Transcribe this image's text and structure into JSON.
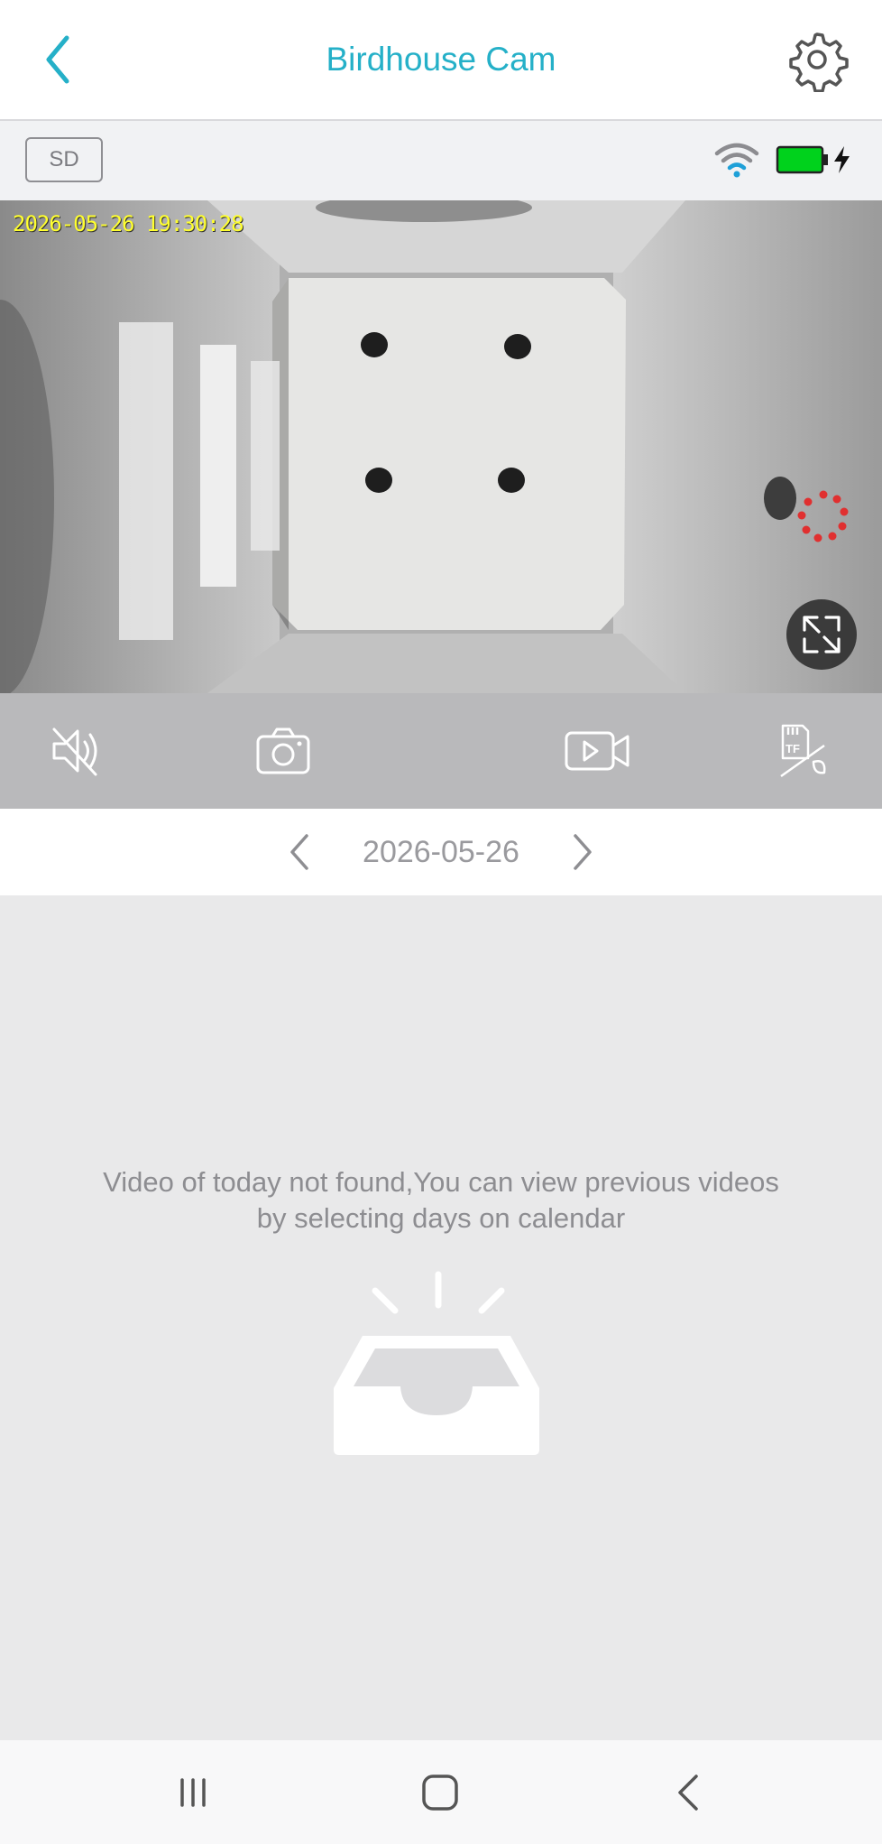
{
  "header": {
    "title": "Birdhouse Cam",
    "back_icon": "chevron-left-icon",
    "settings_icon": "gear-icon"
  },
  "status": {
    "quality_label": "SD",
    "wifi_icon": "wifi-icon",
    "battery_icon": "battery-icon",
    "charging_icon": "lightning-bolt-icon"
  },
  "video": {
    "timestamp": "2026-05-26  19:30:28",
    "loading_icon": "loading-spinner-icon",
    "fullscreen_icon": "expand-icon"
  },
  "controls": {
    "items": [
      {
        "icon": "speaker-muted-icon"
      },
      {
        "icon": "camera-snapshot-icon"
      },
      {
        "icon": "video-record-icon"
      },
      {
        "icon": "tf-card-disabled-icon"
      }
    ]
  },
  "date_nav": {
    "date": "2026-05-26",
    "prev_icon": "chevron-left-icon",
    "next_icon": "chevron-right-icon"
  },
  "empty_state": {
    "message_line1": "Video of today not found,You can view previous videos",
    "message_line2": "by selecting days on calendar",
    "icon": "empty-inbox-icon"
  },
  "system_nav": {
    "items": [
      "recent-apps-icon",
      "home-icon",
      "back-icon"
    ]
  },
  "colors": {
    "accent": "#25b0c8",
    "timestamp": "#ffff2e",
    "battery": "#00d21c",
    "spinner": "#e03030"
  }
}
